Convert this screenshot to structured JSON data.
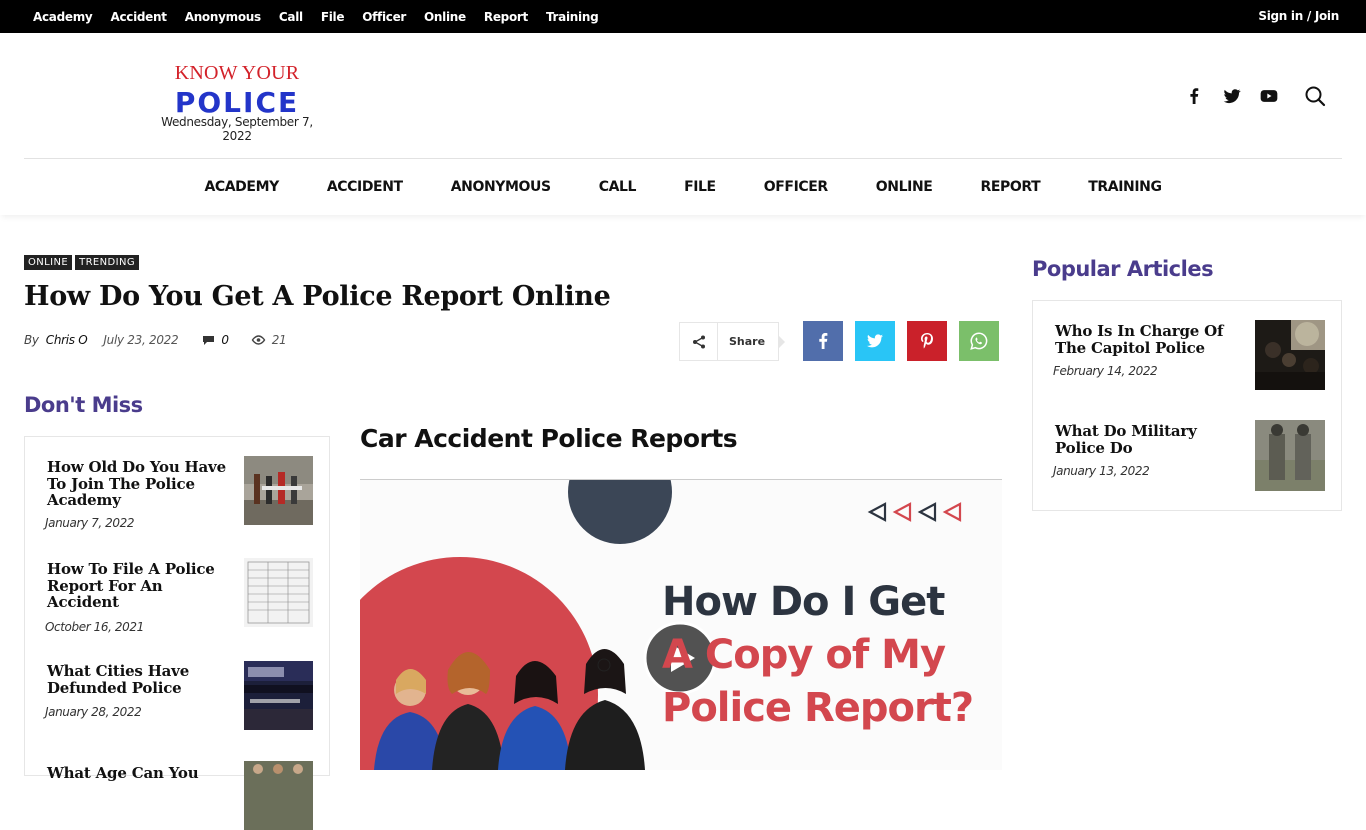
{
  "topbar": {
    "links": [
      "Academy",
      "Accident",
      "Anonymous",
      "Call",
      "File",
      "Officer",
      "Online",
      "Report",
      "Training"
    ],
    "signin": "Sign in / Join"
  },
  "header": {
    "logo_top": "KNOW YOUR",
    "logo_main": "POLICE",
    "date": "Wednesday, September 7, 2022",
    "social_icons": [
      "facebook-icon",
      "twitter-icon",
      "youtube-icon"
    ],
    "search_icon": "search-icon"
  },
  "mainnav": {
    "links": [
      "ACADEMY",
      "ACCIDENT",
      "ANONYMOUS",
      "CALL",
      "FILE",
      "OFFICER",
      "ONLINE",
      "REPORT",
      "TRAINING"
    ]
  },
  "article": {
    "categories": [
      "ONLINE",
      "TRENDING"
    ],
    "title": "How Do You Get A Police Report Online",
    "by": "By",
    "author": "Chris O",
    "date": "July 23, 2022",
    "comments": "0",
    "views": "21",
    "share_label": "Share",
    "share_buttons": [
      {
        "name": "facebook",
        "color": "#516eab"
      },
      {
        "name": "twitter",
        "color": "#29c5f6"
      },
      {
        "name": "pinterest",
        "color": "#ca212a"
      },
      {
        "name": "whatsapp",
        "color": "#7bbf6a"
      }
    ],
    "subheading": "Car Accident Police Reports",
    "hero": {
      "line1": "How Do I Get",
      "line2": "A Copy of My",
      "line3": "Police Report?"
    }
  },
  "dont_miss": {
    "title": "Don't Miss",
    "items": [
      {
        "title": "How Old Do You Have To Join The Police Academy",
        "date": "January 7, 2022"
      },
      {
        "title": "How To File A Police Report For An Accident",
        "date": "October 16, 2021"
      },
      {
        "title": "What Cities Have Defunded Police",
        "date": "January 28, 2022"
      },
      {
        "title": "What Age Can You",
        "date": ""
      }
    ]
  },
  "popular": {
    "title": "Popular Articles",
    "items": [
      {
        "title": "Who Is In Charge Of The Capitol Police",
        "date": "February 14, 2022"
      },
      {
        "title": "What Do Military Police Do",
        "date": "January 13, 2022"
      }
    ]
  },
  "colors": {
    "accent_purple": "#4a3c8c",
    "logo_red": "#d3222a",
    "logo_blue": "#2335c9"
  }
}
